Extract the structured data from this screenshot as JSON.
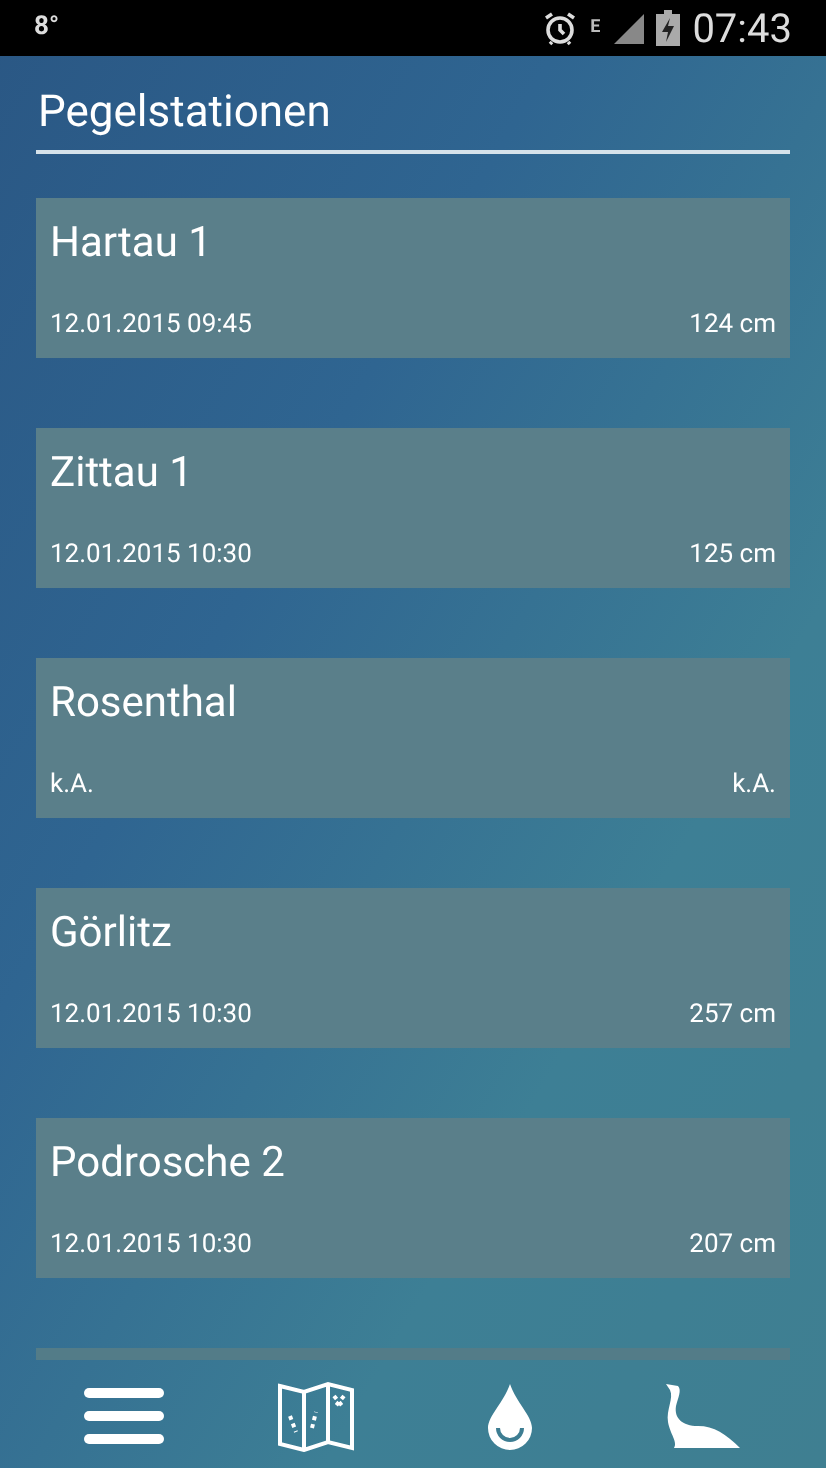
{
  "status_bar": {
    "temperature": "8°",
    "network": "E",
    "time": "07:43"
  },
  "header": {
    "title": "Pegelstationen"
  },
  "stations": [
    {
      "name": "Hartau 1",
      "timestamp": "12.01.2015 09:45",
      "level": "124 cm"
    },
    {
      "name": "Zittau 1",
      "timestamp": "12.01.2015 10:30",
      "level": "125 cm"
    },
    {
      "name": "Rosenthal",
      "timestamp": "k.A.",
      "level": "k.A."
    },
    {
      "name": "Görlitz",
      "timestamp": "12.01.2015 10:30",
      "level": "257 cm"
    },
    {
      "name": "Podrosche 2",
      "timestamp": "12.01.2015 10:30",
      "level": "207 cm"
    }
  ],
  "bottom_nav": [
    {
      "kind": "menu"
    },
    {
      "kind": "map"
    },
    {
      "kind": "drop"
    },
    {
      "kind": "animal"
    }
  ]
}
